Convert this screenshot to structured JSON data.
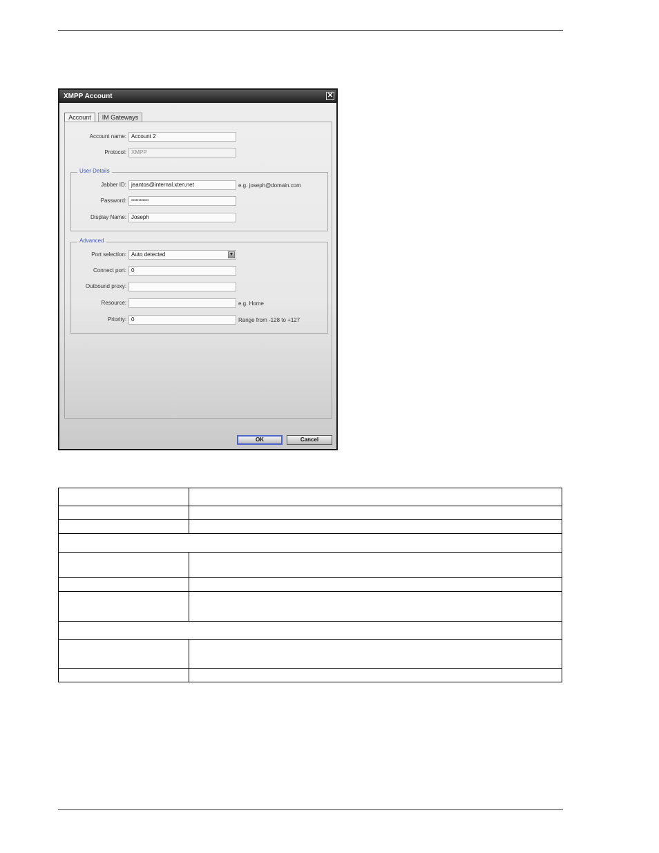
{
  "dialog": {
    "title": "XMPP Account",
    "close_glyph": "✕",
    "tabs": [
      {
        "label": "Account",
        "active": true
      },
      {
        "label": "IM Gateways",
        "active": false
      }
    ],
    "account": {
      "name_label": "Account name:",
      "name_value": "Account 2",
      "protocol_label": "Protocol:",
      "protocol_value": "XMPP"
    },
    "user_details": {
      "legend": "User Details",
      "jabber_label": "Jabber ID:",
      "jabber_value": "jeantos@internal.xten.net",
      "jabber_hint": "e.g. joseph@domain.com",
      "password_label": "Password:",
      "password_value": "••••••••••••",
      "display_label": "Display Name:",
      "display_value": "Joseph"
    },
    "advanced": {
      "legend": "Advanced",
      "port_selection_label": "Port selection:",
      "port_selection_value": "Auto detected",
      "connect_port_label": "Connect port:",
      "connect_port_value": "0",
      "outbound_proxy_label": "Outbound proxy:",
      "outbound_proxy_value": "",
      "resource_label": "Resource:",
      "resource_value": "",
      "resource_hint": "e.g. Home",
      "priority_label": "Priority:",
      "priority_value": "0",
      "priority_hint": "Range from -128 to +127"
    },
    "buttons": {
      "ok": "OK",
      "cancel": "Cancel"
    },
    "icons": {
      "close": "close-icon",
      "dropdown": "chevron-down-icon"
    },
    "colors": {
      "legend": "#3c56c8",
      "titlebar": "#1f1f1f",
      "ok_border": "#4a63c8"
    }
  }
}
